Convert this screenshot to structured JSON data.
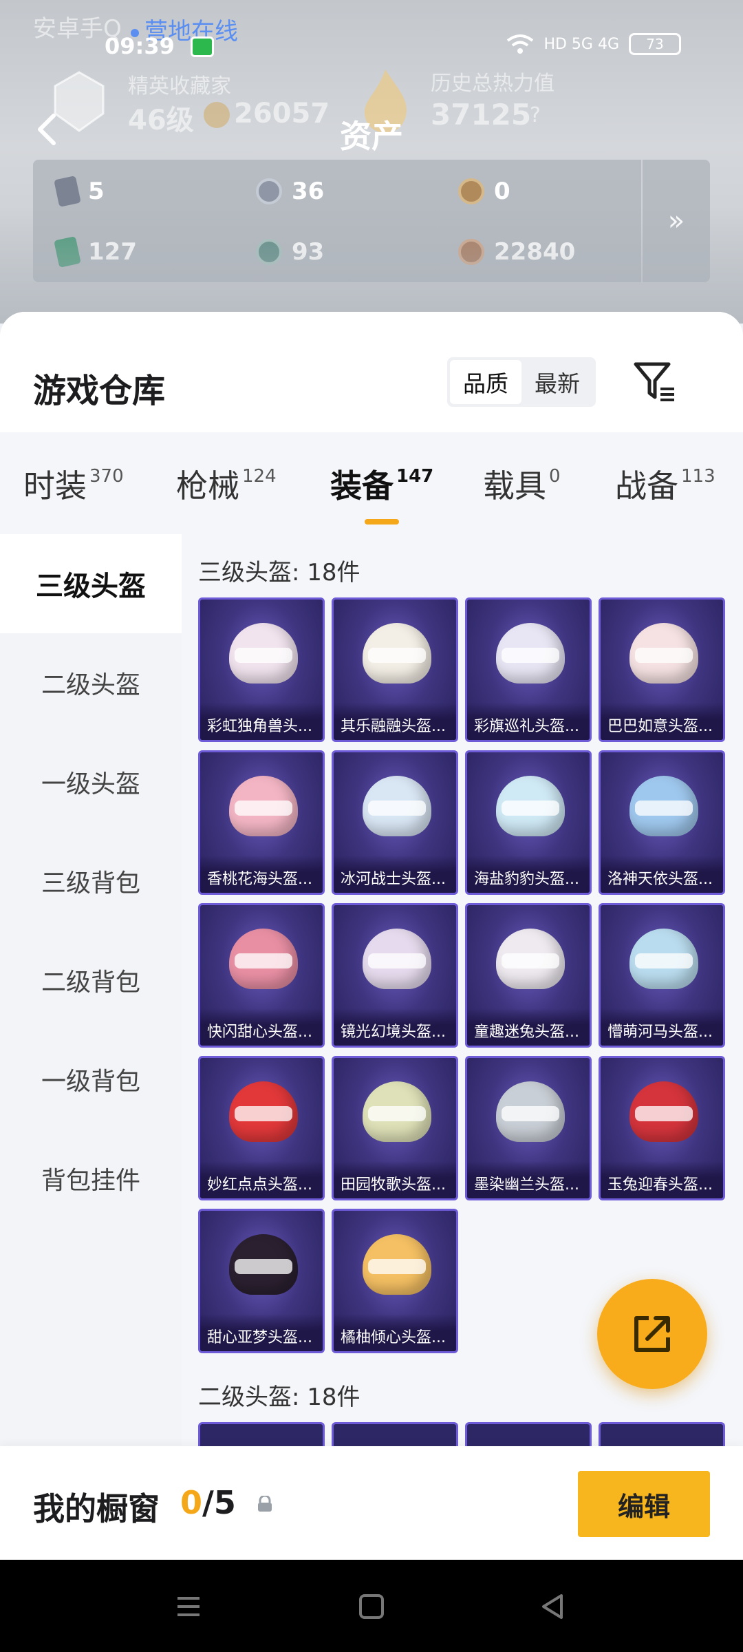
{
  "status_bar": {
    "time": "09:39",
    "network": "HD 5G 4G",
    "battery": "73"
  },
  "background": {
    "online_text": "营地在线",
    "faded_left": "安卓手Q",
    "rank_label": "精英收藏家",
    "level": "46级",
    "score": "26057",
    "heat_label": "历史总热力值",
    "heat_value": "37125",
    "help": "?"
  },
  "header": {
    "title": "资产",
    "back_icon": "chevron-left-icon"
  },
  "stats": {
    "values": [
      "5",
      "36",
      "0",
      "127",
      "93",
      "22840"
    ],
    "more_icon": "double-chevron-right-icon"
  },
  "warehouse": {
    "title": "游戏仓库",
    "sort_options": [
      "品质",
      "最新"
    ],
    "active_sort": "品质",
    "filter_icon": "filter-icon"
  },
  "tabs": [
    {
      "label": "时装",
      "count": "370"
    },
    {
      "label": "枪械",
      "count": "124"
    },
    {
      "label": "装备",
      "count": "147"
    },
    {
      "label": "载具",
      "count": "0"
    },
    {
      "label": "战备",
      "count": "113"
    }
  ],
  "active_tab": "装备",
  "side_categories": [
    "三级头盔",
    "二级头盔",
    "一级头盔",
    "三级背包",
    "二级背包",
    "一级背包",
    "背包挂件"
  ],
  "active_category": "三级头盔",
  "sections": [
    {
      "title": "三级头盔: 18件",
      "items": [
        {
          "name": "彩虹独角兽头...",
          "color": "#f2e4ef"
        },
        {
          "name": "其乐融融头盔...",
          "color": "#f4efe6"
        },
        {
          "name": "彩旗巡礼头盔...",
          "color": "#e8e6f4"
        },
        {
          "name": "巴巴如意头盔...",
          "color": "#f6e2e2"
        },
        {
          "name": "香桃花海头盔...",
          "color": "#f3b5c4"
        },
        {
          "name": "冰河战士头盔...",
          "color": "#d9e6f4"
        },
        {
          "name": "海盐豹豹头盔...",
          "color": "#cfe9f5"
        },
        {
          "name": "洛神天依头盔...",
          "color": "#9fc8ee"
        },
        {
          "name": "快闪甜心头盔...",
          "color": "#e98fa4"
        },
        {
          "name": "镜光幻境头盔...",
          "color": "#e6dbee"
        },
        {
          "name": "童趣迷兔头盔...",
          "color": "#eeeaf0"
        },
        {
          "name": "懵萌河马头盔...",
          "color": "#b9dcee"
        },
        {
          "name": "妙红点点头盔...",
          "color": "#e2383a"
        },
        {
          "name": "田园牧歌头盔...",
          "color": "#dfe2b8"
        },
        {
          "name": "墨染幽兰头盔...",
          "color": "#c9cfd6"
        },
        {
          "name": "玉兔迎春头盔...",
          "color": "#d5343c"
        },
        {
          "name": "甜心亚梦头盔...",
          "color": "#2b2030"
        },
        {
          "name": "橘柚倾心头盔...",
          "color": "#f5c063"
        }
      ]
    },
    {
      "title": "二级头盔: 18件"
    }
  ],
  "showcase": {
    "title": "我的橱窗",
    "current": "0",
    "total": "/5",
    "lock_icon": "lock-icon",
    "edit_label": "编辑"
  },
  "fab_icon": "share-out-icon",
  "nav": [
    "menu-icon",
    "home-icon",
    "back-icon"
  ]
}
